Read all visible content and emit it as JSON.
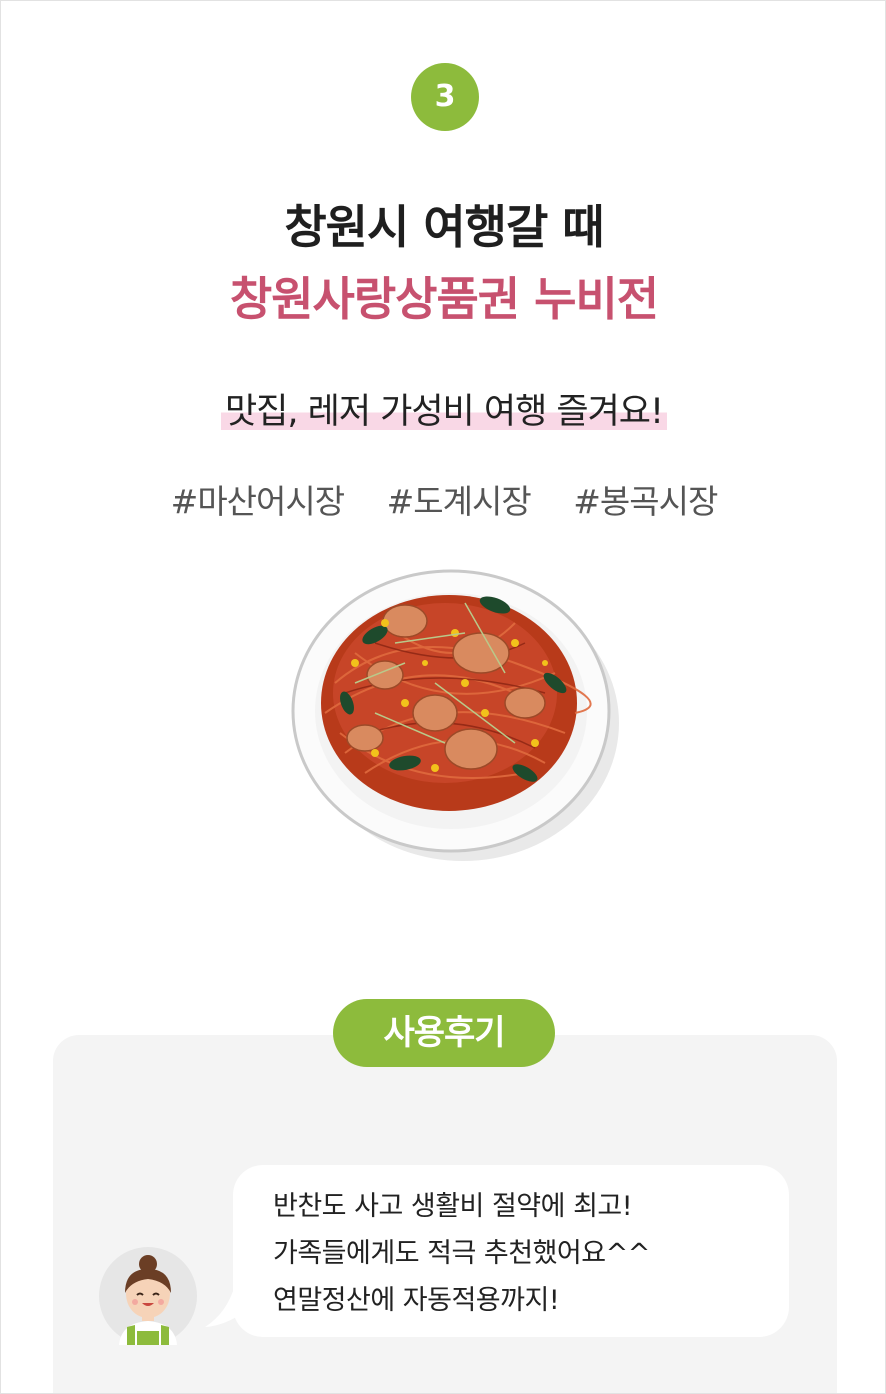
{
  "step": {
    "number": "3"
  },
  "headline": {
    "line1": "창원시 여행갈 때",
    "line2": "창원사랑상품권 누비전"
  },
  "subtitle": "맛집, 레저 가성비 여행 즐겨요!",
  "tags": [
    "#마산어시장",
    "#도계시장",
    "#봉곡시장"
  ],
  "review": {
    "badge": "사용후기",
    "lines": [
      "반찬도 사고 생활비 절약에 최고!",
      "가족들에게도 적극 추천했어요^^",
      "연말정산에 자동적용까지!"
    ]
  },
  "colors": {
    "accent_green": "#8dbb3c",
    "accent_pink": "#c7516f",
    "highlight": "#f9d8e6"
  },
  "icons": {
    "dish": "spicy-noodle-plate-illustration",
    "avatar": "smiling-woman-avatar"
  }
}
